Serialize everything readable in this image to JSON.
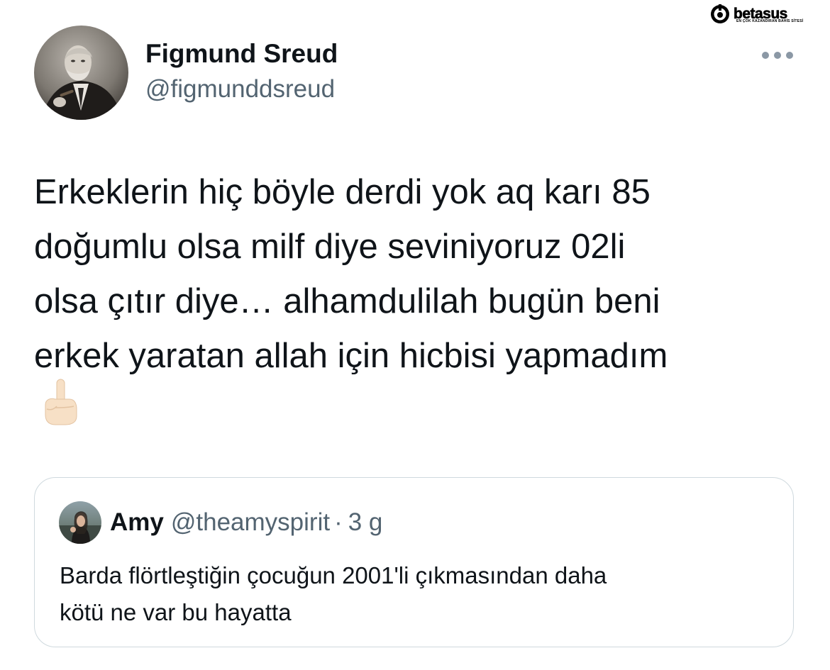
{
  "watermark": {
    "brand": "betasus",
    "tagline": "EN ÇOK KAZANDIRAN BAHİS SİTESİ"
  },
  "tweet": {
    "author": {
      "display_name": "Figmund Sreud",
      "handle": "@figmunddsreud"
    },
    "text_lines": [
      "Erkeklerin hiç böyle derdi yok aq karı 85",
      "doğumlu olsa milf diye seviniyoruz 02li",
      "olsa çıtır diye… alhamdulilah bugün beni",
      "erkek yaratan allah için hicbisi yapmadım"
    ],
    "emoji": "pointing-up-finger",
    "more_icon": "ellipsis-icon"
  },
  "quoted_tweet": {
    "author": {
      "display_name": "Amy",
      "handle": "@theamyspirit"
    },
    "separator": "·",
    "time": "3 g",
    "text_lines": [
      "Barda flörtleştiğin çocuğun 2001'li çıkmasından daha",
      "kötü ne var bu hayatta"
    ]
  },
  "colors": {
    "text_primary": "#0f1419",
    "text_secondary": "#536471",
    "border": "#cfd9de",
    "icon_gray": "#8b98a5"
  }
}
